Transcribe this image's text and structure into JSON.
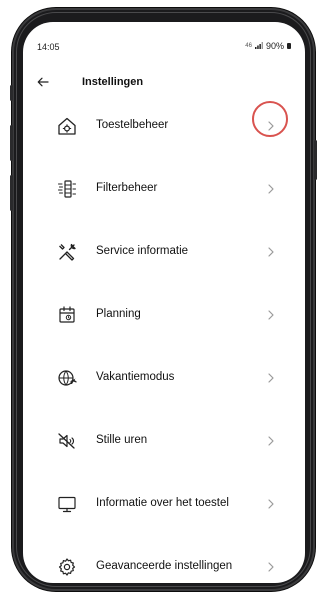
{
  "status_bar": {
    "time": "14:05",
    "signal_text": "46",
    "battery": "90%"
  },
  "header": {
    "title": "Instellingen"
  },
  "menu_items": [
    {
      "label": "Toestelbeheer",
      "icon": "house-settings-icon"
    },
    {
      "label": "Filterbeheer",
      "icon": "filter-icon"
    },
    {
      "label": "Service informatie",
      "icon": "tools-icon"
    },
    {
      "label": "Planning",
      "icon": "calendar-icon"
    },
    {
      "label": "Vakantiemodus",
      "icon": "globe-plane-icon"
    },
    {
      "label": "Stille uren",
      "icon": "mute-icon"
    },
    {
      "label": "Informatie over het toestel",
      "icon": "monitor-icon"
    },
    {
      "label": "Geavanceerde instellingen",
      "icon": "gear-icon"
    }
  ],
  "highlight": {
    "target_index": 0,
    "color": "#d9534f"
  },
  "colors": {
    "text": "#111111",
    "chevron": "#9a9a9a",
    "frame": "#1b1b1d"
  }
}
